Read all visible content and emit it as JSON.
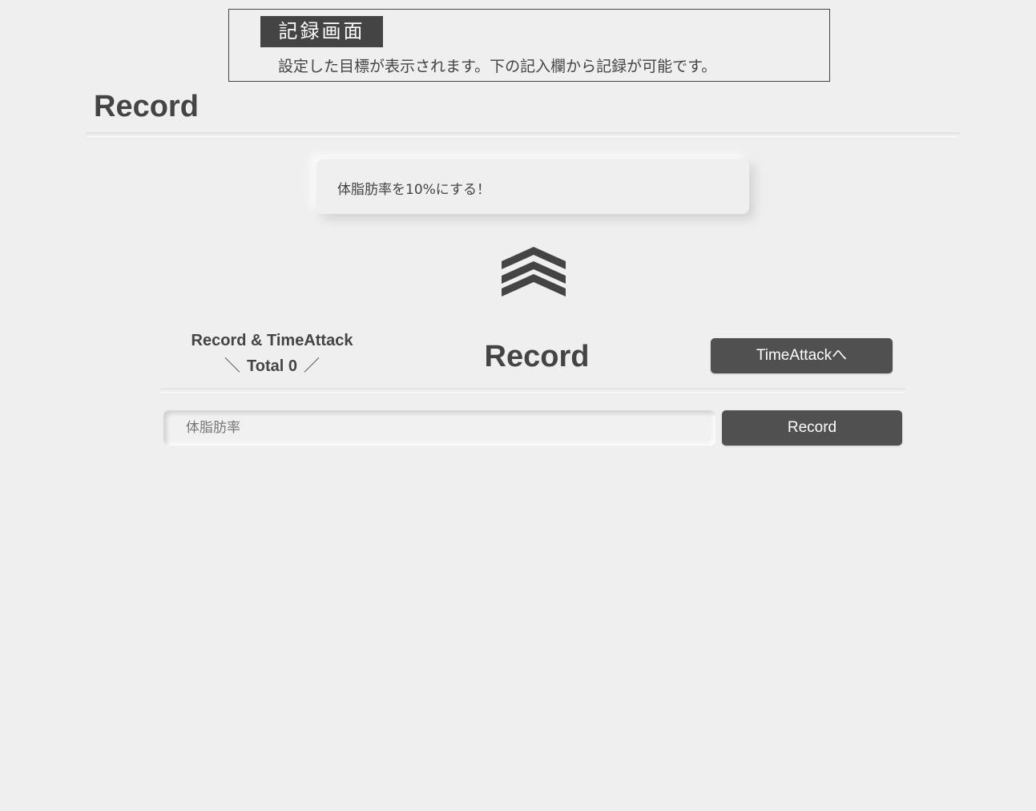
{
  "annotation": {
    "badge": "記録画面",
    "description": "設定した目標が表示されます。下の記入欄から記録が可能です。"
  },
  "page": {
    "title": "Record"
  },
  "goal": {
    "text": "体脂肪率を10%にする！"
  },
  "icons": {
    "chevron": "triple-chevron-up-icon"
  },
  "stats": {
    "title": "Record & TimeAttack",
    "left_deco": "＼",
    "total_label": "Total 0",
    "right_deco": "／"
  },
  "section": {
    "title": "Record",
    "timeattack_button": "TimeAttackへ"
  },
  "form": {
    "input_placeholder": "体脂肪率",
    "input_value": "",
    "submit_label": "Record"
  },
  "colors": {
    "background": "#efefef",
    "accent_dark": "#444444",
    "button": "#505050",
    "button_text": "#ffffff"
  }
}
